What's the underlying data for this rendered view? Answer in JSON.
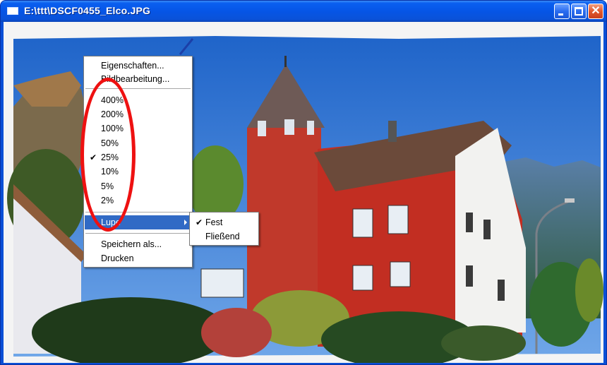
{
  "window": {
    "title": "E:\\ttt\\DSCF0455_Elco.JPG",
    "icon": "window-icon",
    "buttons": {
      "minimize": "minimize-icon",
      "maximize": "maximize-icon",
      "close": "close-icon"
    },
    "close_glyph": "✕"
  },
  "menu": {
    "properties": "Eigenschaften...",
    "edit_image": "Bildbearbeitung...",
    "zoom_levels": [
      "400%",
      "200%",
      "100%",
      "50%",
      "25%",
      "10%",
      "5%",
      "2%"
    ],
    "zoom_selected": "25%",
    "check_glyph": "✔",
    "magnifier": "Lupe",
    "save_as": "Speichern als...",
    "print": "Drucken"
  },
  "submenu": {
    "fixed": "Fest",
    "floating": "Fließend",
    "selected": "Fest"
  },
  "colors": {
    "titlebar": "#0a5ff0",
    "menu_highlight": "#316ac5",
    "annotation": "#ee1111"
  }
}
